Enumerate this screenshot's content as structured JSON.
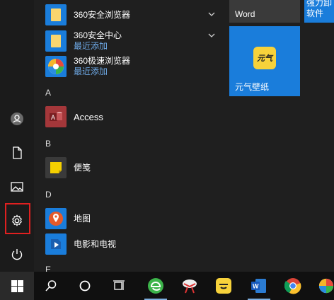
{
  "applist": {
    "items": [
      {
        "name": "360安全浏览器",
        "sub": "",
        "icon": "folder-icon",
        "expandable": true
      },
      {
        "name": "360安全中心",
        "sub": "最近添加",
        "icon": "folder-icon",
        "expandable": true
      },
      {
        "name": "360极速浏览器",
        "sub": "最近添加",
        "icon": "360-speed-browser-icon",
        "expandable": false
      }
    ],
    "letters": {
      "a": "A",
      "b": "B",
      "d": "D",
      "e": "E"
    },
    "access": "Access",
    "sticky": "便笺",
    "maps": "地图",
    "movies": "电影和电视"
  },
  "tiles": {
    "word": "Word",
    "yuanqi": "元气壁纸",
    "yuanqi_logo": "元气",
    "partial": [
      "强力卸",
      "软件"
    ]
  },
  "colors": {
    "accent": "#1a7ddb",
    "highlight": "#e02020",
    "link": "#6ea9e6"
  },
  "rail_icons": [
    "user-icon",
    "document-icon",
    "pictures-icon",
    "settings-icon",
    "power-icon"
  ],
  "taskbar_icons": [
    "windows-start-icon",
    "search-icon",
    "cortana-icon",
    "task-view-icon",
    "360-browser-icon",
    "uninstall-tool-icon",
    "yuanqi-icon",
    "word-icon",
    "chrome-icon",
    "360-speed-browser-icon"
  ]
}
